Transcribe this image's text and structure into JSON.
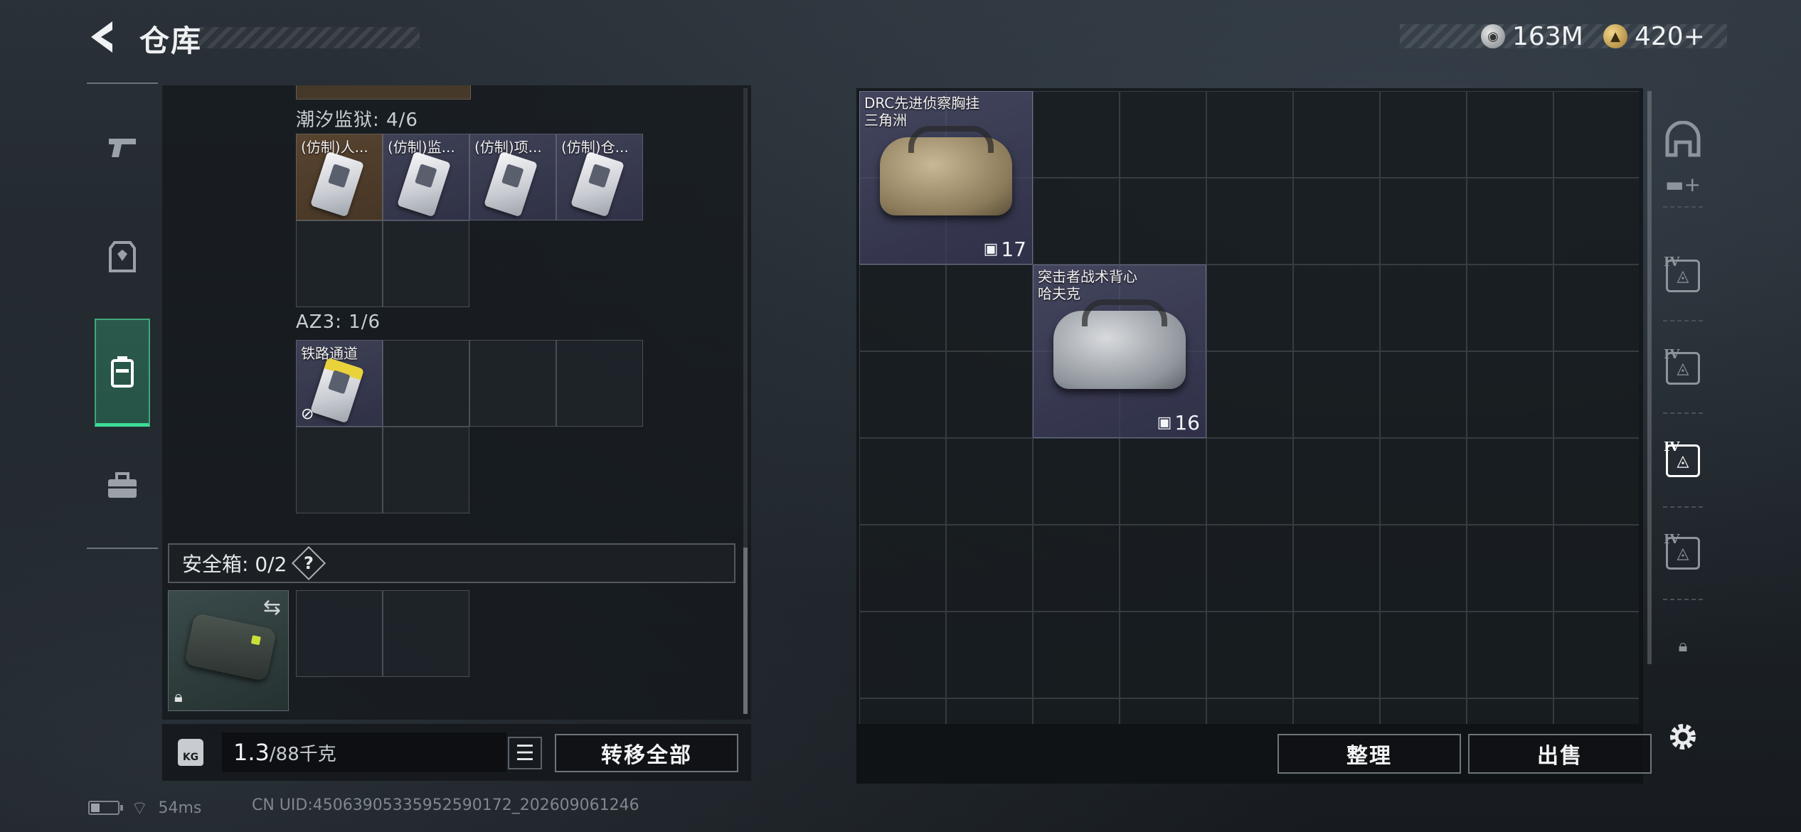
{
  "header": {
    "title": "仓库",
    "back_icon": "chevron-left-icon",
    "currencies": [
      {
        "icon": "silver-coin-icon",
        "value": "163M"
      },
      {
        "icon": "gold-coin-icon",
        "value": "420+"
      }
    ]
  },
  "left_nav": {
    "items": [
      {
        "icon": "pistol-icon",
        "active": false
      },
      {
        "icon": "armor-vest-icon",
        "active": false
      },
      {
        "icon": "backpack-icon",
        "active": true
      },
      {
        "icon": "briefcase-icon",
        "active": false
      }
    ]
  },
  "containers": [
    {
      "label": "潮汐监狱: 4/6",
      "items": [
        {
          "name": "(仿制)人...",
          "icon": "keycard-icon"
        },
        {
          "name": "(仿制)监...",
          "icon": "keycard-icon"
        },
        {
          "name": "(仿制)项...",
          "icon": "keycard-icon"
        },
        {
          "name": "(仿制)仓...",
          "icon": "keycard-icon"
        }
      ]
    },
    {
      "label": "AZ3: 1/6",
      "items": [
        {
          "name": "铁路通道",
          "icon": "keycard-icon",
          "badge": "no-trade-icon"
        }
      ]
    }
  ],
  "safebox": {
    "label": "安全箱: 0/2",
    "help": "?"
  },
  "bottom_left": {
    "weight_current": "1.3",
    "weight_max": "/88千克",
    "kg_label": "KG",
    "transfer_all": "转移全部"
  },
  "stash": {
    "items": [
      {
        "name_line1": "DRC先进侦察胸挂",
        "name_line2": "三角洲",
        "capacity": "17",
        "color": "#b8a57c"
      },
      {
        "name_line1": "突击者战术背心",
        "name_line2": "哈夫克",
        "capacity": "16",
        "color": "#c9cbcf"
      }
    ]
  },
  "right_rail": {
    "tier_label": "IV"
  },
  "actions": {
    "sort": "整理",
    "sell": "出售"
  },
  "status": {
    "ping": "54ms",
    "uid": "CN UID:4506390533595259017​2_202609061246"
  }
}
